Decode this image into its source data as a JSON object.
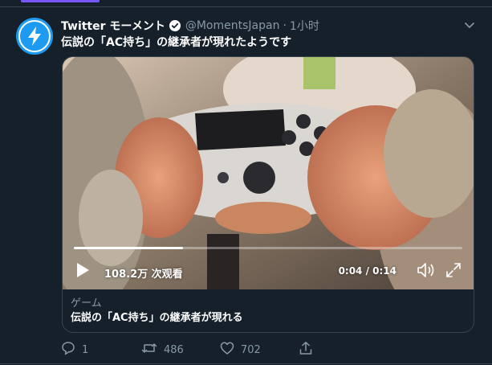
{
  "tweet": {
    "display_name": "Twitter モーメント",
    "handle": "@MomentsJapan",
    "separator": "·",
    "time": "1小时",
    "text": "伝説の「AC持ち」の継承者が現れたようです"
  },
  "video": {
    "views": "108.2万 次观看",
    "timecode": "0:04 / 0:14",
    "progress": 0.28
  },
  "card": {
    "category": "ゲーム",
    "title": "伝説の「AC持ち」の継承者が現れる"
  },
  "actions": {
    "reply_count": "1",
    "retweet_count": "486",
    "like_count": "702"
  },
  "icons": {
    "avatar": "lightning-bolt-icon",
    "verified": "verified-badge-icon",
    "caret": "chevron-down-icon",
    "play": "play-icon",
    "volume": "volume-icon",
    "fullscreen": "fullscreen-icon",
    "reply": "reply-icon",
    "retweet": "retweet-icon",
    "like": "heart-icon",
    "share": "share-icon"
  },
  "colors": {
    "background": "#15202b",
    "accent": "#1d9bf0",
    "muted_text": "#8899a6",
    "border": "#38444d",
    "tab_indicator": "#7856ff"
  }
}
